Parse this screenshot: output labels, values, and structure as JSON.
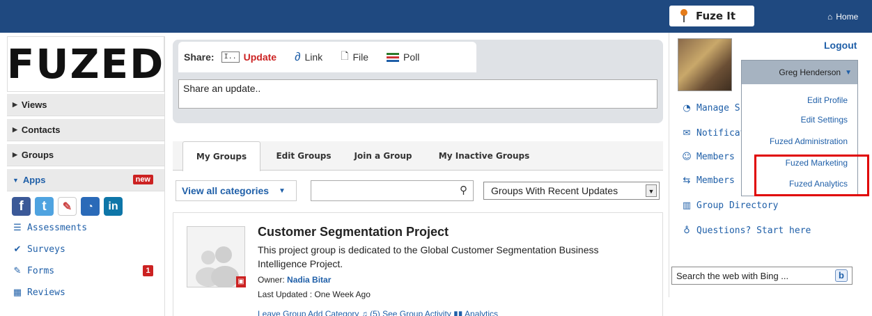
{
  "header": {
    "fuzeit_label": "Fuze It",
    "home_label": "Home"
  },
  "logo": {
    "text": "FUZED"
  },
  "sidebar": {
    "nav": [
      {
        "label": "Views"
      },
      {
        "label": "Contacts"
      },
      {
        "label": "Groups"
      },
      {
        "label": "Apps",
        "badge": "new"
      }
    ],
    "social": [
      "f",
      "t",
      "✎",
      "rss",
      "in"
    ],
    "items": [
      {
        "label": "Assessments",
        "icon": "list-icon"
      },
      {
        "label": "Surveys",
        "icon": "check-icon"
      },
      {
        "label": "Forms",
        "icon": "pencil-icon",
        "badge": "1"
      },
      {
        "label": "Reviews",
        "icon": "table-icon"
      }
    ]
  },
  "share": {
    "label": "Share:",
    "tabs": [
      "Update",
      "Link",
      "File",
      "Poll"
    ],
    "placeholder": "Share an update.."
  },
  "groups": {
    "tabs": [
      "My Groups",
      "Edit Groups",
      "Join a Group",
      "My Inactive Groups"
    ],
    "view_all": "View all categories",
    "sort_selected": "Groups With Recent Updates",
    "card": {
      "title": "Customer Segmentation Project",
      "description": "This project group is dedicated to the Global Customer Segmentation Business Intelligence Project.",
      "owner_label": "Owner:",
      "owner_name": "Nadia Bitar",
      "updated": "Last Updated : One Week Ago",
      "actions": "Leave Group  Add Category  ♫ (5)  See Group Activity  ▮▮ Analytics"
    }
  },
  "right": {
    "logout": "Logout",
    "user_name": "Greg Henderson",
    "menu": [
      "Edit Profile",
      "Edit Settings",
      "Fuzed Administration",
      "Fuzed Marketing",
      "Fuzed Analytics"
    ],
    "links": [
      {
        "label": "Manage S",
        "icon": "rss-icon"
      },
      {
        "label": "Notificati",
        "icon": "notification-icon"
      },
      {
        "label": "Members",
        "icon": "member-icon"
      },
      {
        "label": "Members",
        "icon": "members-icon"
      },
      {
        "label": "Group Directory",
        "icon": "directory-icon"
      },
      {
        "label": "Questions? Start here",
        "icon": "bulb-icon"
      }
    ],
    "bing_placeholder": "Search the web with Bing ..."
  }
}
